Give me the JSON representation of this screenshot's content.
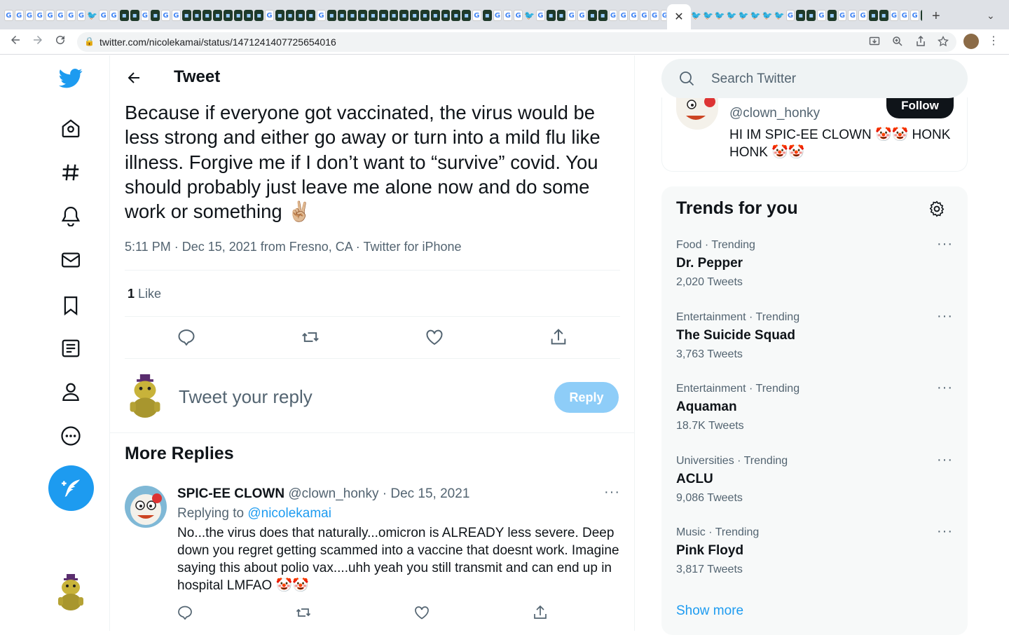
{
  "browser": {
    "url": "twitter.com/nicolekamai/status/1471241407725654016",
    "active_tab_close": "✕",
    "new_tab": "+",
    "tab_list": "⌄"
  },
  "nav": {
    "items": [
      "twitter-logo",
      "home-icon",
      "explore-icon",
      "notifications-icon",
      "messages-icon",
      "bookmarks-icon",
      "lists-icon",
      "profile-icon",
      "more-icon"
    ]
  },
  "header": {
    "title": "Tweet"
  },
  "tweet": {
    "text": "Because if everyone got vaccinated, the virus would be less strong and either go away or turn into a mild flu like illness. Forgive me if I don’t want to “survive” covid. You should probably just leave me alone now and do some work or something ✌🏼",
    "meta": "5:11 PM · Dec 15, 2021 from Fresno, CA · Twitter for iPhone",
    "like_count": "1",
    "like_label": " Like"
  },
  "composer": {
    "placeholder": "Tweet your reply",
    "reply_button": "Reply"
  },
  "more_replies": {
    "title": "More Replies",
    "reply": {
      "name": "SPIC-EE CLOWN",
      "handle_date": " @clown_honky · Dec 15, 2021",
      "replying_label": "Replying to ",
      "replying_handle": "@nicolekamai",
      "text": "No...the virus does that naturally...omicron is ALREADY less severe. Deep down you regret getting scammed into a vaccine that doesnt work. Imagine saying this about polio vax....uhh yeah you still transmit and can end up in hospital LMFAO 🤡🤡"
    }
  },
  "search": {
    "placeholder": "Search Twitter"
  },
  "who_to_follow": {
    "handle": "@clown_honky",
    "follow_label": "Follow",
    "bio": "HI IM SPIC-EE CLOWN 🤡🤡 HONK HONK 🤡🤡"
  },
  "trends": {
    "title": "Trends for you",
    "items": [
      {
        "context": "Food · Trending",
        "name": "Dr. Pepper",
        "count": "2,020 Tweets"
      },
      {
        "context": "Entertainment · Trending",
        "name": "The Suicide Squad",
        "count": "3,763 Tweets"
      },
      {
        "context": "Entertainment · Trending",
        "name": "Aquaman",
        "count": "18.7K Tweets"
      },
      {
        "context": "Universities · Trending",
        "name": "ACLU",
        "count": "9,086 Tweets"
      },
      {
        "context": "Music · Trending",
        "name": "Pink Floyd",
        "count": "3,817 Tweets"
      }
    ],
    "show_more": "Show more",
    "more_glyph": "···"
  },
  "colors": {
    "accent": "#1d9bf0",
    "text": "#0f1419",
    "secondary": "#536471",
    "reply_disabled": "#8ecdf8"
  }
}
